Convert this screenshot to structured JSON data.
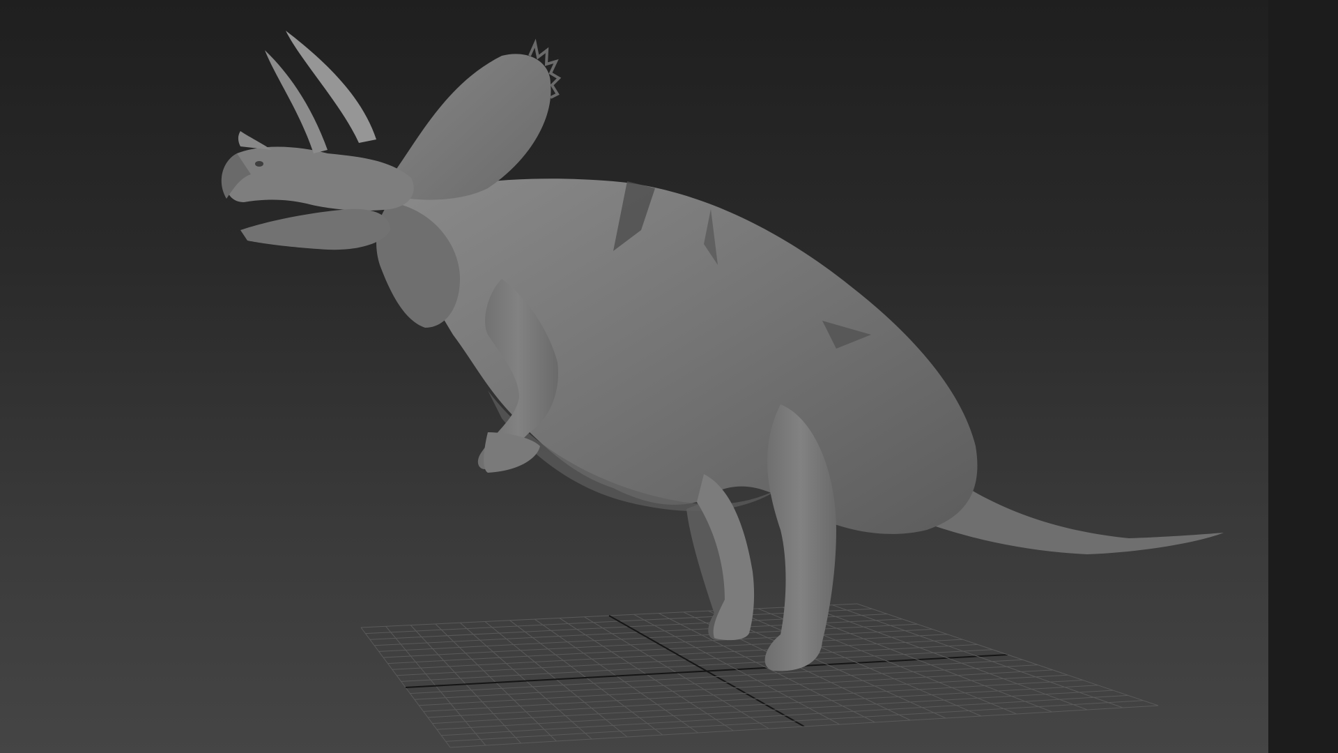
{
  "viewport": {
    "background_top": "#1f1f1f",
    "background_bottom": "#454545",
    "side_panel_color": "#1c1c1c"
  },
  "model": {
    "subject": "triceratops",
    "shading": "flat-gray",
    "body_color": "#777777",
    "shadow_color": "#4d4d4d",
    "highlight_color": "#8e8e8e"
  },
  "grid": {
    "line_color": "#5a5a5a",
    "axis_color": "#151515"
  }
}
